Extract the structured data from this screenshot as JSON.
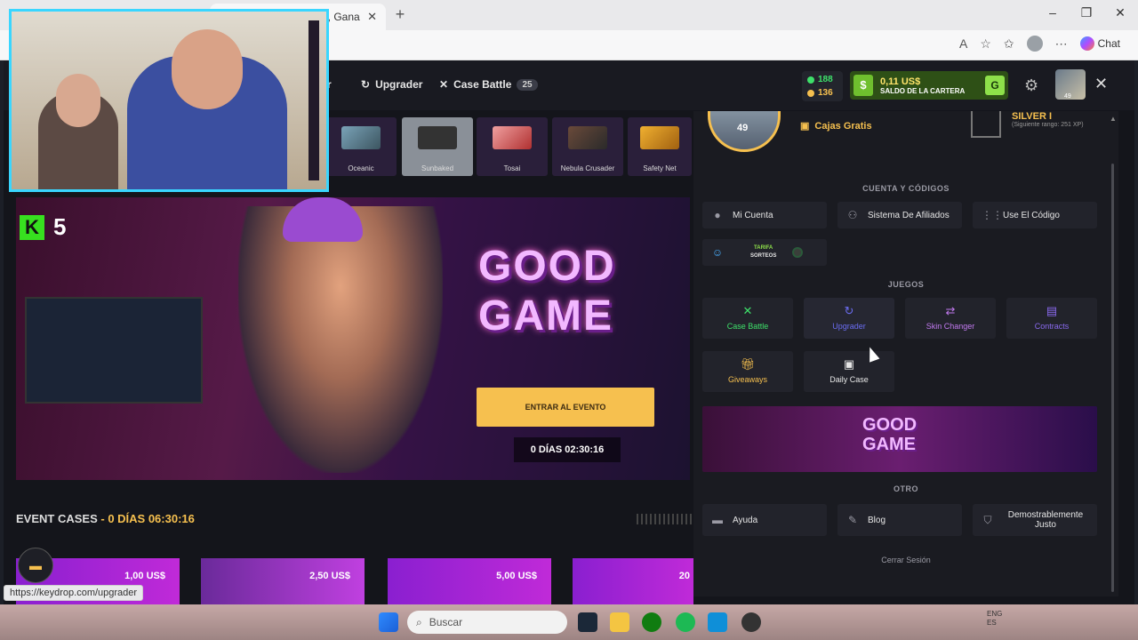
{
  "browser": {
    "tab_title": "D), Gana",
    "new_tab": "+",
    "min": "–",
    "max": "❐",
    "close": "✕",
    "chat_label": "Chat",
    "status_url": "https://keydrop.com/upgrader"
  },
  "header": {
    "nav": [
      {
        "label": "ger",
        "icon": "upgrade-icon"
      },
      {
        "label": "Upgrader",
        "icon": "upgrade-icon"
      },
      {
        "label": "Case Battle",
        "icon": "swords-icon",
        "count": "25"
      }
    ],
    "gems": "188",
    "coins": "136",
    "wallet_amount": "0,11 US$",
    "wallet_label": "SALDO DE LA CARTERA",
    "wallet_btn": "G",
    "dollar": "$",
    "avatar_level": "49"
  },
  "case_strip": [
    "Oceanic",
    "Sunbaked",
    "Tosai",
    "Nebula Crusader",
    "Safety Net"
  ],
  "banner": {
    "k_label": "K",
    "k_number": "5",
    "logo_line1": "GOOD",
    "logo_line2": "GAME",
    "enter_button": "ENTRAR AL EVENTO",
    "timer": "0 DÍAS 02:30:16"
  },
  "event_cases": {
    "title": "EVENT CASES",
    "timer": "- 0 DÍAS 06:30:16",
    "prices": [
      "1,00 US$",
      "2,50 US$",
      "5,00 US$",
      "20"
    ]
  },
  "panel": {
    "level": "49",
    "cajas": "Cajas Gratis",
    "rank": "SILVER I",
    "next_rank": "(Siguiente rango: 251 XP)",
    "section_account": "CUENTA Y CÓDIGOS",
    "account_buttons": [
      "Mi Cuenta",
      "Sistema De Afiliados",
      "Use El Código"
    ],
    "tarifa_line1": "TARIFA",
    "tarifa_line2": "SORTEOS",
    "section_games": "JUEGOS",
    "games": [
      {
        "label": "Case Battle",
        "color": "#3ee06a",
        "icon": "swords-icon"
      },
      {
        "label": "Upgrader",
        "color": "#6a6cf0",
        "icon": "upgrade-icon"
      },
      {
        "label": "Skin Changer",
        "color": "#c27af0",
        "icon": "swap-icon"
      },
      {
        "label": "Contracts",
        "color": "#8a6af0",
        "icon": "clipboard-icon"
      },
      {
        "label": "Giveaways",
        "color": "#f6c04f",
        "icon": "gift-icon"
      },
      {
        "label": "Daily Case",
        "color": "#e6e6e6",
        "icon": "box-icon"
      }
    ],
    "promo_line1": "GOOD",
    "promo_line2": "GAME",
    "section_other": "OTRO",
    "other_buttons": [
      "Ayuda",
      "Blog",
      "Demostrablemente Justo"
    ],
    "logout": "Cerrar Sesión"
  },
  "taskbar": {
    "search": "Buscar",
    "tray_lang_1": "ENG",
    "tray_lang_2": "ES"
  }
}
